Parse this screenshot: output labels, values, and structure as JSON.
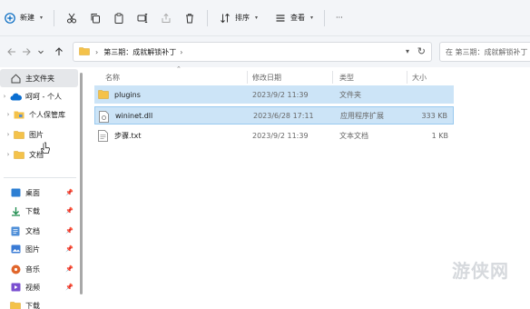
{
  "toolbar": {
    "new_label": "新建",
    "sort_label": "排序",
    "view_label": "查看",
    "more_label": "···"
  },
  "nav": {
    "breadcrumb": "第三期：成就解锁补丁",
    "search_placeholder": "在 第三期：成就解锁补丁 中搜索"
  },
  "sidebar": {
    "items": [
      {
        "label": "主文件夹"
      },
      {
        "label": "呵呵 - 个人"
      },
      {
        "label": "个人保管库"
      },
      {
        "label": "图片"
      },
      {
        "label": "文档"
      }
    ],
    "quick_access": [
      {
        "label": "桌面"
      },
      {
        "label": "下载"
      },
      {
        "label": "文档"
      },
      {
        "label": "图片"
      },
      {
        "label": "音乐"
      },
      {
        "label": "视频"
      },
      {
        "label": "下载"
      }
    ]
  },
  "columns": {
    "name": "名称",
    "modified": "修改日期",
    "type": "类型",
    "size": "大小"
  },
  "files": [
    {
      "name": "plugins",
      "modified": "2023/9/2 11:39",
      "type": "文件夹",
      "size": ""
    },
    {
      "name": "wininet.dll",
      "modified": "2023/6/28 17:11",
      "type": "应用程序扩展",
      "size": "333 KB"
    },
    {
      "name": "步骤.txt",
      "modified": "2023/9/2 11:39",
      "type": "文本文档",
      "size": "1 KB"
    }
  ],
  "watermark": "游侠网",
  "colors": {
    "selection": "#cce4f7",
    "folder": "#f4c24a",
    "accent": "#0067c0"
  }
}
